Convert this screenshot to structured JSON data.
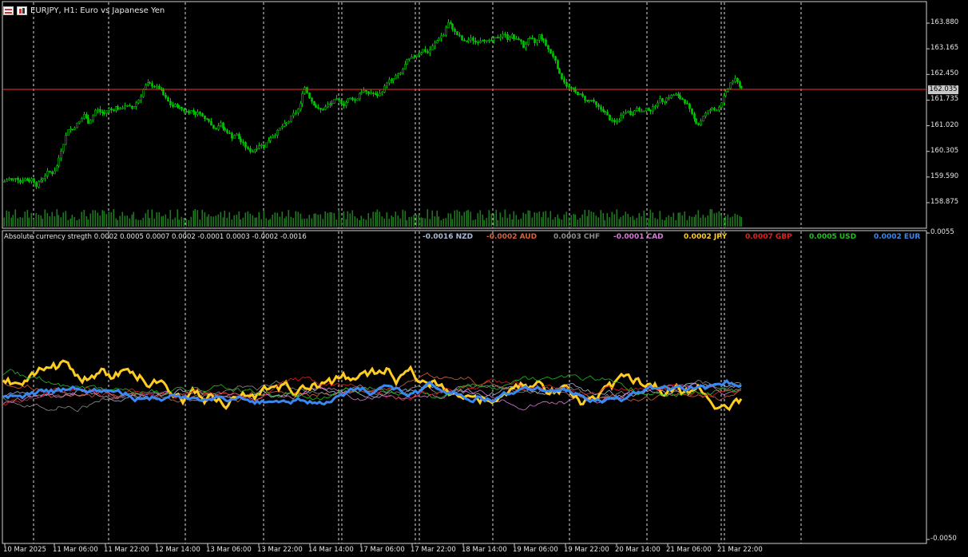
{
  "window": {
    "title": "EURJPY, H1:  Euro vs Japanese Yen",
    "icons": [
      "chart-grid-icon",
      "one-click-trading-icon"
    ]
  },
  "price_chart": {
    "symbol": "EURJPY",
    "timeframe": "H1",
    "y_ticks": [
      "163.880",
      "163.165",
      "162.450",
      "161.735",
      "161.020",
      "160.305",
      "159.590",
      "158.875"
    ],
    "y_tick_values": [
      163.88,
      163.165,
      162.45,
      161.735,
      161.02,
      160.305,
      159.59,
      158.875
    ],
    "current_price": "162.035",
    "colors": {
      "candles": "#00c800",
      "price_line": "#ff3030",
      "background": "#000000",
      "grid": "#ffffff",
      "volumes": "#1f7a1f"
    },
    "close_path": [
      [
        0,
        159.41
      ],
      [
        5,
        159.47
      ],
      [
        10,
        159.55
      ],
      [
        15,
        159.5
      ],
      [
        20,
        159.6
      ],
      [
        25,
        159.45
      ],
      [
        30,
        159.55
      ],
      [
        35,
        159.48
      ],
      [
        40,
        159.55
      ],
      [
        45,
        159.35
      ],
      [
        50,
        159.5
      ],
      [
        55,
        159.6
      ],
      [
        60,
        159.75
      ],
      [
        65,
        159.7
      ],
      [
        70,
        159.85
      ],
      [
        75,
        160.25
      ],
      [
        80,
        160.6
      ],
      [
        85,
        160.95
      ],
      [
        90,
        160.9
      ],
      [
        95,
        161.05
      ],
      [
        100,
        161.15
      ],
      [
        105,
        161.35
      ],
      [
        110,
        161.1
      ],
      [
        115,
        161.25
      ],
      [
        120,
        161.5
      ],
      [
        125,
        161.4
      ],
      [
        130,
        161.35
      ],
      [
        135,
        161.5
      ],
      [
        140,
        161.45
      ],
      [
        145,
        161.55
      ],
      [
        150,
        161.45
      ],
      [
        155,
        161.6
      ],
      [
        160,
        161.55
      ],
      [
        165,
        161.5
      ],
      [
        170,
        161.65
      ],
      [
        175,
        161.8
      ],
      [
        180,
        162.1
      ],
      [
        185,
        162.2
      ],
      [
        190,
        162.15
      ],
      [
        195,
        162.1
      ],
      [
        200,
        162.05
      ],
      [
        205,
        161.85
      ],
      [
        210,
        161.7
      ],
      [
        215,
        161.55
      ],
      [
        220,
        161.6
      ],
      [
        225,
        161.5
      ],
      [
        230,
        161.45
      ],
      [
        235,
        161.4
      ],
      [
        240,
        161.45
      ],
      [
        245,
        161.35
      ],
      [
        250,
        161.4
      ],
      [
        255,
        161.2
      ],
      [
        260,
        161.25
      ],
      [
        265,
        161.0
      ],
      [
        270,
        160.95
      ],
      [
        275,
        161.1
      ],
      [
        280,
        160.9
      ],
      [
        285,
        160.85
      ],
      [
        290,
        160.7
      ],
      [
        295,
        160.8
      ],
      [
        300,
        160.6
      ],
      [
        305,
        160.5
      ],
      [
        310,
        160.35
      ],
      [
        315,
        160.3
      ],
      [
        320,
        160.4
      ],
      [
        325,
        160.5
      ],
      [
        330,
        160.45
      ],
      [
        335,
        160.6
      ],
      [
        340,
        160.75
      ],
      [
        345,
        160.8
      ],
      [
        350,
        160.95
      ],
      [
        355,
        161.05
      ],
      [
        360,
        161.1
      ],
      [
        365,
        161.3
      ],
      [
        370,
        161.4
      ],
      [
        375,
        161.55
      ],
      [
        380,
        162.15
      ],
      [
        385,
        161.9
      ],
      [
        390,
        161.7
      ],
      [
        395,
        161.55
      ],
      [
        400,
        161.45
      ],
      [
        405,
        161.5
      ],
      [
        410,
        161.6
      ],
      [
        415,
        161.65
      ],
      [
        420,
        161.75
      ],
      [
        425,
        161.7
      ],
      [
        430,
        161.6
      ],
      [
        435,
        161.75
      ],
      [
        440,
        161.8
      ],
      [
        445,
        161.7
      ],
      [
        450,
        161.95
      ],
      [
        455,
        162.0
      ],
      [
        460,
        161.9
      ],
      [
        465,
        161.95
      ],
      [
        470,
        161.85
      ],
      [
        475,
        161.9
      ],
      [
        480,
        162.05
      ],
      [
        485,
        162.3
      ],
      [
        490,
        162.25
      ],
      [
        495,
        162.4
      ],
      [
        500,
        162.45
      ],
      [
        505,
        162.65
      ],
      [
        510,
        162.85
      ],
      [
        515,
        162.9
      ],
      [
        520,
        163.0
      ],
      [
        525,
        163.05
      ],
      [
        530,
        163.15
      ],
      [
        535,
        163.05
      ],
      [
        540,
        163.2
      ],
      [
        545,
        163.35
      ],
      [
        550,
        163.5
      ],
      [
        555,
        163.55
      ],
      [
        560,
        163.9
      ],
      [
        565,
        163.8
      ],
      [
        570,
        163.6
      ],
      [
        575,
        163.5
      ],
      [
        580,
        163.35
      ],
      [
        585,
        163.4
      ],
      [
        590,
        163.45
      ],
      [
        595,
        163.35
      ],
      [
        600,
        163.4
      ],
      [
        605,
        163.45
      ],
      [
        610,
        163.35
      ],
      [
        615,
        163.4
      ],
      [
        620,
        163.45
      ],
      [
        625,
        163.5
      ],
      [
        630,
        163.6
      ],
      [
        635,
        163.45
      ],
      [
        640,
        163.55
      ],
      [
        645,
        163.4
      ],
      [
        650,
        163.45
      ],
      [
        655,
        163.2
      ],
      [
        660,
        163.4
      ],
      [
        665,
        163.45
      ],
      [
        670,
        163.3
      ],
      [
        675,
        163.55
      ],
      [
        680,
        163.4
      ],
      [
        685,
        163.2
      ],
      [
        690,
        163.0
      ],
      [
        695,
        162.85
      ],
      [
        700,
        162.45
      ],
      [
        705,
        162.3
      ],
      [
        710,
        162.1
      ],
      [
        715,
        162.05
      ],
      [
        720,
        161.95
      ],
      [
        725,
        161.9
      ],
      [
        730,
        161.8
      ],
      [
        735,
        161.7
      ],
      [
        740,
        161.75
      ],
      [
        745,
        161.6
      ],
      [
        750,
        161.5
      ],
      [
        755,
        161.45
      ],
      [
        760,
        161.3
      ],
      [
        765,
        161.15
      ],
      [
        770,
        161.1
      ],
      [
        775,
        161.2
      ],
      [
        780,
        161.4
      ],
      [
        785,
        161.45
      ],
      [
        790,
        161.3
      ],
      [
        795,
        161.5
      ],
      [
        800,
        161.45
      ],
      [
        805,
        161.4
      ],
      [
        810,
        161.5
      ],
      [
        815,
        161.45
      ],
      [
        820,
        161.6
      ],
      [
        825,
        161.75
      ],
      [
        830,
        161.7
      ],
      [
        835,
        161.8
      ],
      [
        840,
        161.85
      ],
      [
        845,
        161.9
      ],
      [
        850,
        161.8
      ],
      [
        855,
        161.75
      ],
      [
        860,
        161.6
      ],
      [
        865,
        161.35
      ],
      [
        870,
        161.15
      ],
      [
        875,
        161.05
      ],
      [
        880,
        161.3
      ],
      [
        885,
        161.4
      ],
      [
        890,
        161.5
      ],
      [
        895,
        161.45
      ],
      [
        900,
        161.55
      ],
      [
        905,
        161.8
      ],
      [
        910,
        162.0
      ],
      [
        915,
        162.25
      ],
      [
        920,
        162.3
      ],
      [
        925,
        162.15
      ],
      [
        930,
        162.05
      ]
    ]
  },
  "indicator": {
    "label": "Absolute currency stregth 0.0002 0.0005 0.0007 0.0002 -0.0001 0.0003 -0.0002 -0.0016",
    "y_ticks": [
      "0.0055",
      "-0.0050"
    ],
    "y_tick_values": [
      0.0055,
      -0.005
    ],
    "legend": [
      {
        "text": "-0.0016 NZD",
        "color": "#a9b9d6"
      },
      {
        "text": "-0.0002 AUD",
        "color": "#d8623a"
      },
      {
        "text": "0.0003 CHF",
        "color": "#8c8c8c"
      },
      {
        "text": "-0.0001 CAD",
        "color": "#d87ad8"
      },
      {
        "text": "0.0002 JPY",
        "color": "#ffcc22"
      },
      {
        "text": "0.0007 GBP",
        "color": "#e12020"
      },
      {
        "text": "0.0005 USD",
        "color": "#20c020"
      },
      {
        "text": "0.0002 EUR",
        "color": "#3a88f0"
      }
    ]
  },
  "time_axis": {
    "labels": [
      "10 Mar 2025",
      "11 Mar 06:00",
      "11 Mar 22:00",
      "12 Mar 14:00",
      "13 Mar 06:00",
      "13 Mar 22:00",
      "14 Mar 14:00",
      "17 Mar 06:00",
      "17 Mar 22:00",
      "18 Mar 14:00",
      "19 Mar 06:00",
      "19 Mar 22:00",
      "20 Mar 14:00",
      "21 Mar 06:00",
      "21 Mar 22:00"
    ]
  }
}
